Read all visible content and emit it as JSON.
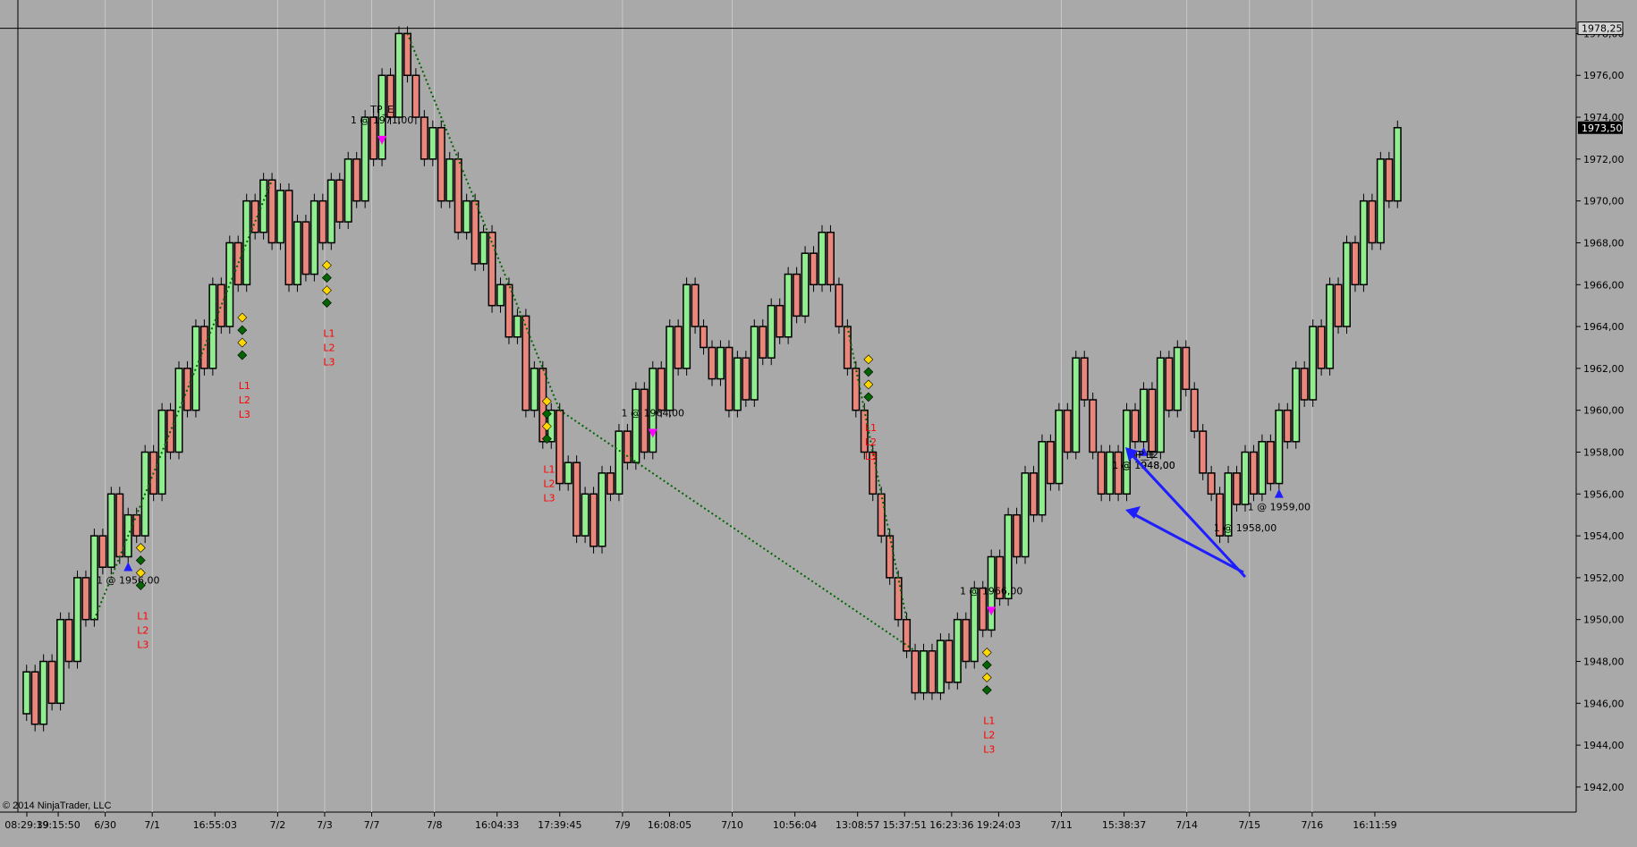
{
  "chart_data": {
    "type": "candlestick-renko",
    "copyright": "© 2014 NinjaTrader, LLC",
    "y_axis": {
      "ticks": [
        "1942,00",
        "1944,00",
        "1946,00",
        "1948,00",
        "1950,00",
        "1952,00",
        "1954,00",
        "1956,00",
        "1958,00",
        "1960,00",
        "1962,00",
        "1964,00",
        "1966,00",
        "1968,00",
        "1970,00",
        "1972,00",
        "1974,00",
        "1976,00",
        "1978,00"
      ],
      "tick_values": [
        1942,
        1944,
        1946,
        1948,
        1950,
        1952,
        1954,
        1956,
        1958,
        1960,
        1962,
        1964,
        1966,
        1968,
        1970,
        1972,
        1974,
        1976,
        1978
      ],
      "range": [
        1940.8,
        1979.6
      ]
    },
    "crosshair_label": "1978,25",
    "crosshair_value": 1978.25,
    "last_price_label": "1973,50",
    "last_price_value": 1973.5,
    "x_axis": {
      "labels": [
        "08:29:39",
        "19:15:50",
        "6/30",
        "7/1",
        "16:55:03",
        "7/2",
        "7/3",
        "7/7",
        "7/8",
        "16:04:33",
        "17:39:45",
        "7/9",
        "16:08:05",
        "7/10",
        "10:56:04",
        "13:08:57",
        "15:37:51",
        "16:23:36",
        "19:24:03",
        "7/11",
        "15:38:37",
        "7/14",
        "7/15",
        "7/16",
        "16:11:59"
      ],
      "label_positions_index": [
        0,
        2,
        5,
        8,
        12,
        16,
        19,
        22,
        26,
        30,
        34,
        38,
        41,
        45,
        49,
        53,
        56,
        59,
        62,
        66,
        70,
        74,
        78,
        82,
        86
      ],
      "slots": 88
    },
    "price_path": [
      1945.5,
      1947.5,
      1945,
      1948,
      1946,
      1950,
      1948,
      1952,
      1950,
      1954,
      1952.5,
      1956,
      1953,
      1955,
      1954,
      1958,
      1956,
      1960,
      1958,
      1962,
      1960,
      1964,
      1962,
      1966,
      1964,
      1968,
      1966,
      1970,
      1968.5,
      1971,
      1968,
      1970.5,
      1966,
      1969,
      1966.5,
      1970,
      1968,
      1971,
      1969,
      1972,
      1970,
      1974,
      1972,
      1976,
      1974,
      1978,
      1976,
      1974,
      1972,
      1973.5,
      1970,
      1972,
      1968.5,
      1970,
      1967,
      1968.5,
      1965,
      1966,
      1963.5,
      1964.5,
      1960,
      1962,
      1958.5,
      1960,
      1956.5,
      1957.5,
      1954,
      1956,
      1953.5,
      1957,
      1956,
      1959,
      1957.5,
      1961,
      1958,
      1962,
      1960,
      1964,
      1962,
      1966,
      1964,
      1963,
      1961.5,
      1963,
      1960,
      1962.5,
      1960.5,
      1964,
      1962.5,
      1965,
      1963.5,
      1966.5,
      1964.5,
      1967.5,
      1966,
      1968.5,
      1966,
      1964,
      1962,
      1960,
      1958,
      1956,
      1954,
      1952,
      1950,
      1948.5,
      1946.5,
      1948.5,
      1946.5,
      1949,
      1947,
      1950,
      1948,
      1951.5,
      1949.5,
      1953,
      1951,
      1955,
      1953,
      1957,
      1955,
      1958.5,
      1956.5,
      1960,
      1958,
      1962.5,
      1960.5,
      1958,
      1956,
      1958,
      1956,
      1960,
      1958.5,
      1961,
      1958,
      1962.5,
      1960,
      1963,
      1961,
      1959,
      1957,
      1956,
      1954,
      1957,
      1955.5,
      1958,
      1956,
      1958.5,
      1956.5,
      1960,
      1958.5,
      1962,
      1960.5,
      1964,
      1962,
      1966,
      1964,
      1968,
      1966,
      1970,
      1968,
      1972,
      1970,
      1973.5
    ],
    "signals": [
      {
        "label": "TP_E",
        "sub": "1 @ 1971,00",
        "index": 21,
        "dir": "down"
      },
      {
        "label": "",
        "sub": "1 @ 1956,00",
        "index": 6,
        "dir": "up"
      },
      {
        "label": "",
        "sub": "1 @ 1964,00",
        "index": 37,
        "dir": "down"
      },
      {
        "label": "",
        "sub": "1 @ 1966,00",
        "index": 57,
        "dir": "down"
      },
      {
        "label": "TP_E",
        "sub": "1 @ 1948,00",
        "index": 66,
        "dir": "up"
      },
      {
        "label": "TP_E2",
        "sub": "1 @ 1948,00",
        "index": 66,
        "dir": "none"
      },
      {
        "label": "",
        "sub": "1 @ 1959,00",
        "index": 74,
        "dir": "up"
      },
      {
        "label": "",
        "sub": "1 @ 1958,00",
        "index": 72,
        "dir": "none"
      }
    ],
    "level_labels": [
      "L1",
      "L2",
      "L3"
    ]
  }
}
